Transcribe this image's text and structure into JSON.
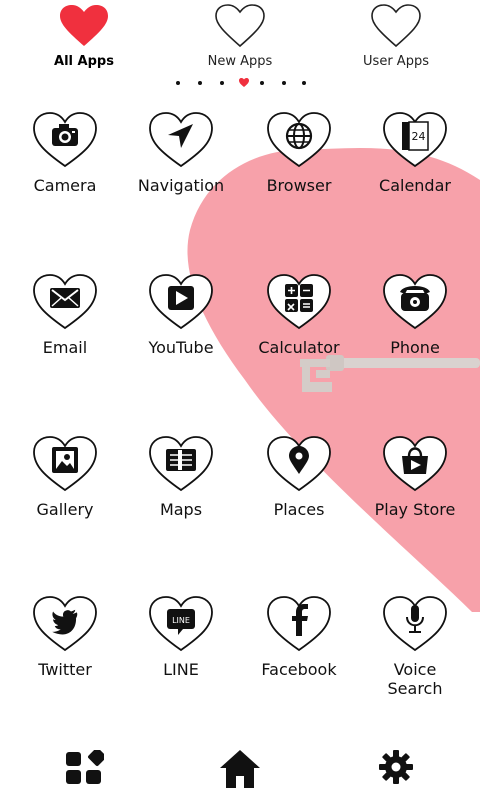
{
  "tabs": [
    {
      "label": "All Apps",
      "active": true
    },
    {
      "label": "New Apps",
      "active": false
    },
    {
      "label": "User Apps",
      "active": false
    }
  ],
  "page_indicator": {
    "count": 7,
    "current": 4
  },
  "apps": [
    {
      "label": "Camera",
      "icon": "camera-icon"
    },
    {
      "label": "Navigation",
      "icon": "navigation-arrow-icon"
    },
    {
      "label": "Browser",
      "icon": "globe-icon"
    },
    {
      "label": "Calendar",
      "icon": "calendar-icon"
    },
    {
      "label": "Email",
      "icon": "envelope-icon"
    },
    {
      "label": "YouTube",
      "icon": "play-icon"
    },
    {
      "label": "Calculator",
      "icon": "calculator-icon"
    },
    {
      "label": "Phone",
      "icon": "telephone-icon"
    },
    {
      "label": "Gallery",
      "icon": "picture-icon"
    },
    {
      "label": "Maps",
      "icon": "map-icon"
    },
    {
      "label": "Places",
      "icon": "map-pin-icon"
    },
    {
      "label": "Play Store",
      "icon": "shopping-bag-icon"
    },
    {
      "label": "Twitter",
      "icon": "bird-icon"
    },
    {
      "label": "LINE",
      "icon": "line-chat-icon"
    },
    {
      "label": "Facebook",
      "icon": "facebook-f-icon"
    },
    {
      "label": "Voice\nSearch",
      "icon": "microphone-icon"
    }
  ],
  "calendar_day": "24",
  "line_icon_text": "LINE",
  "dock": [
    {
      "icon": "app-drawer-icon"
    },
    {
      "icon": "home-icon"
    },
    {
      "icon": "settings-gear-icon"
    }
  ],
  "colors": {
    "accent_heart": "#f0303e",
    "background_heart": "#f8a0a8",
    "key": "#d8d0cc",
    "ink": "#111111"
  }
}
